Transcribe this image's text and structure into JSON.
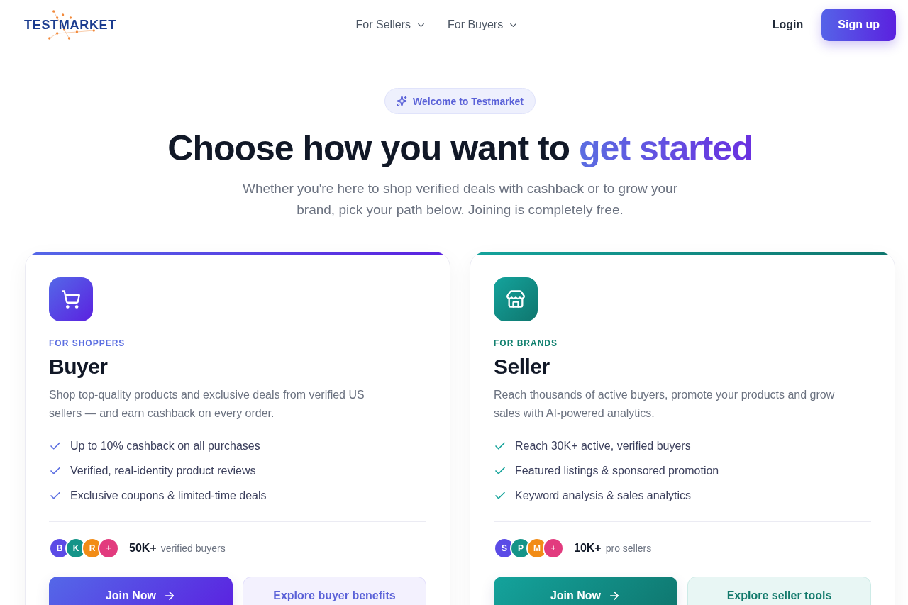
{
  "header": {
    "logo": "TESTMARKET",
    "nav": [
      {
        "label": "For Sellers"
      },
      {
        "label": "For Buyers"
      }
    ],
    "login": "Login",
    "signup": "Sign up"
  },
  "hero": {
    "badge": "Welcome to Testmarket",
    "title": "Choose how you want to",
    "title_highlight": "get started",
    "subtitle": "Whether you're here to shop verified deals with cashback or to grow your brand, pick your path below. Joining is completely free."
  },
  "cards": [
    {
      "kind": "buyer",
      "eyebrow": "FOR SHOPPERS",
      "title": "Buyer",
      "description": "Shop top-quality products and exclusive deals from verified US sellers — and earn cashback on every order.",
      "features": [
        "Up to 10% cashback on all purchases",
        "Verified, real-identity product reviews",
        "Exclusive coupons & limited-time deals"
      ],
      "avatars": [
        {
          "initial": "B",
          "color": "#5b4be6"
        },
        {
          "initial": "K",
          "color": "#149488"
        },
        {
          "initial": "R",
          "color": "#f28c16"
        },
        {
          "initial": "+",
          "color": "#e23b7e"
        }
      ],
      "stat_count": "50K+",
      "stat_label": "verified buyers",
      "primary_button": "Join Now",
      "secondary_button": "Explore buyer benefits"
    },
    {
      "kind": "seller",
      "eyebrow": "FOR BRANDS",
      "title": "Seller",
      "description": "Reach thousands of active buyers, promote your products and grow sales with AI-powered analytics.",
      "features": [
        "Reach 30K+ active, verified buyers",
        "Featured listings & sponsored promotion",
        "Keyword analysis & sales analytics"
      ],
      "avatars": [
        {
          "initial": "S",
          "color": "#5b4be6"
        },
        {
          "initial": "P",
          "color": "#149488"
        },
        {
          "initial": "M",
          "color": "#f28c16"
        },
        {
          "initial": "+",
          "color": "#e23b7e"
        }
      ],
      "stat_count": "10K+",
      "stat_label": "pro sellers",
      "primary_button": "Join Now",
      "secondary_button": "Explore seller tools"
    }
  ]
}
